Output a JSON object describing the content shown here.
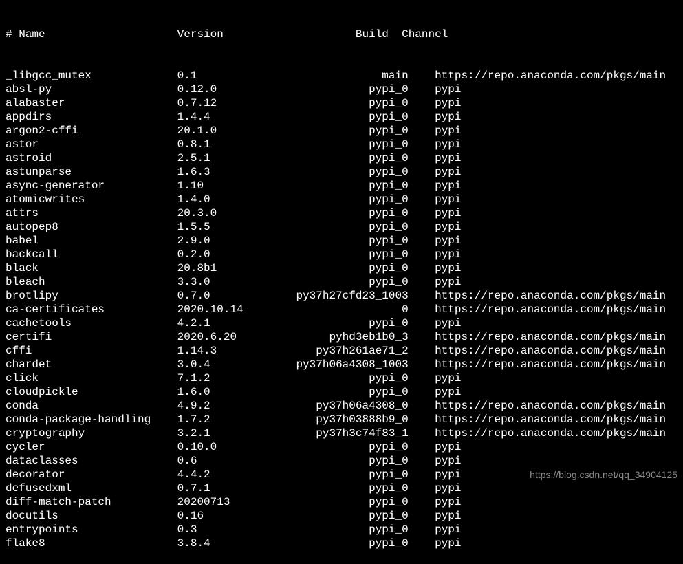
{
  "header": {
    "name": "# Name",
    "version": "Version",
    "build": "Build",
    "channel": "Channel"
  },
  "packages": [
    {
      "name": "_libgcc_mutex",
      "version": "0.1",
      "build": "main",
      "channel": "https://repo.anaconda.com/pkgs/main"
    },
    {
      "name": "absl-py",
      "version": "0.12.0",
      "build": "pypi_0",
      "channel": "pypi"
    },
    {
      "name": "alabaster",
      "version": "0.7.12",
      "build": "pypi_0",
      "channel": "pypi"
    },
    {
      "name": "appdirs",
      "version": "1.4.4",
      "build": "pypi_0",
      "channel": "pypi"
    },
    {
      "name": "argon2-cffi",
      "version": "20.1.0",
      "build": "pypi_0",
      "channel": "pypi"
    },
    {
      "name": "astor",
      "version": "0.8.1",
      "build": "pypi_0",
      "channel": "pypi"
    },
    {
      "name": "astroid",
      "version": "2.5.1",
      "build": "pypi_0",
      "channel": "pypi"
    },
    {
      "name": "astunparse",
      "version": "1.6.3",
      "build": "pypi_0",
      "channel": "pypi"
    },
    {
      "name": "async-generator",
      "version": "1.10",
      "build": "pypi_0",
      "channel": "pypi"
    },
    {
      "name": "atomicwrites",
      "version": "1.4.0",
      "build": "pypi_0",
      "channel": "pypi"
    },
    {
      "name": "attrs",
      "version": "20.3.0",
      "build": "pypi_0",
      "channel": "pypi"
    },
    {
      "name": "autopep8",
      "version": "1.5.5",
      "build": "pypi_0",
      "channel": "pypi"
    },
    {
      "name": "babel",
      "version": "2.9.0",
      "build": "pypi_0",
      "channel": "pypi"
    },
    {
      "name": "backcall",
      "version": "0.2.0",
      "build": "pypi_0",
      "channel": "pypi"
    },
    {
      "name": "black",
      "version": "20.8b1",
      "build": "pypi_0",
      "channel": "pypi"
    },
    {
      "name": "bleach",
      "version": "3.3.0",
      "build": "pypi_0",
      "channel": "pypi"
    },
    {
      "name": "brotlipy",
      "version": "0.7.0",
      "build": "py37h27cfd23_1003",
      "channel": "https://repo.anaconda.com/pkgs/main"
    },
    {
      "name": "ca-certificates",
      "version": "2020.10.14",
      "build": "0",
      "channel": "https://repo.anaconda.com/pkgs/main"
    },
    {
      "name": "cachetools",
      "version": "4.2.1",
      "build": "pypi_0",
      "channel": "pypi"
    },
    {
      "name": "certifi",
      "version": "2020.6.20",
      "build": "pyhd3eb1b0_3",
      "channel": "https://repo.anaconda.com/pkgs/main"
    },
    {
      "name": "cffi",
      "version": "1.14.3",
      "build": "py37h261ae71_2",
      "channel": "https://repo.anaconda.com/pkgs/main"
    },
    {
      "name": "chardet",
      "version": "3.0.4",
      "build": "py37h06a4308_1003",
      "channel": "https://repo.anaconda.com/pkgs/main"
    },
    {
      "name": "click",
      "version": "7.1.2",
      "build": "pypi_0",
      "channel": "pypi"
    },
    {
      "name": "cloudpickle",
      "version": "1.6.0",
      "build": "pypi_0",
      "channel": "pypi"
    },
    {
      "name": "conda",
      "version": "4.9.2",
      "build": "py37h06a4308_0",
      "channel": "https://repo.anaconda.com/pkgs/main"
    },
    {
      "name": "conda-package-handling",
      "version": "1.7.2",
      "build": "py37h03888b9_0",
      "channel": "https://repo.anaconda.com/pkgs/main"
    },
    {
      "name": "cryptography",
      "version": "3.2.1",
      "build": "py37h3c74f83_1",
      "channel": "https://repo.anaconda.com/pkgs/main"
    },
    {
      "name": "cycler",
      "version": "0.10.0",
      "build": "pypi_0",
      "channel": "pypi"
    },
    {
      "name": "dataclasses",
      "version": "0.6",
      "build": "pypi_0",
      "channel": "pypi"
    },
    {
      "name": "decorator",
      "version": "4.4.2",
      "build": "pypi_0",
      "channel": "pypi"
    },
    {
      "name": "defusedxml",
      "version": "0.7.1",
      "build": "pypi_0",
      "channel": "pypi"
    },
    {
      "name": "diff-match-patch",
      "version": "20200713",
      "build": "pypi_0",
      "channel": "pypi"
    },
    {
      "name": "docutils",
      "version": "0.16",
      "build": "pypi_0",
      "channel": "pypi"
    },
    {
      "name": "entrypoints",
      "version": "0.3",
      "build": "pypi_0",
      "channel": "pypi"
    },
    {
      "name": "flake8",
      "version": "3.8.4",
      "build": "pypi_0",
      "channel": "pypi"
    }
  ],
  "watermark": "https://blog.csdn.net/qq_34904125",
  "columns": {
    "name_width": 26,
    "version_width": 17,
    "build_width": 18,
    "build_pad_offset": 2
  }
}
